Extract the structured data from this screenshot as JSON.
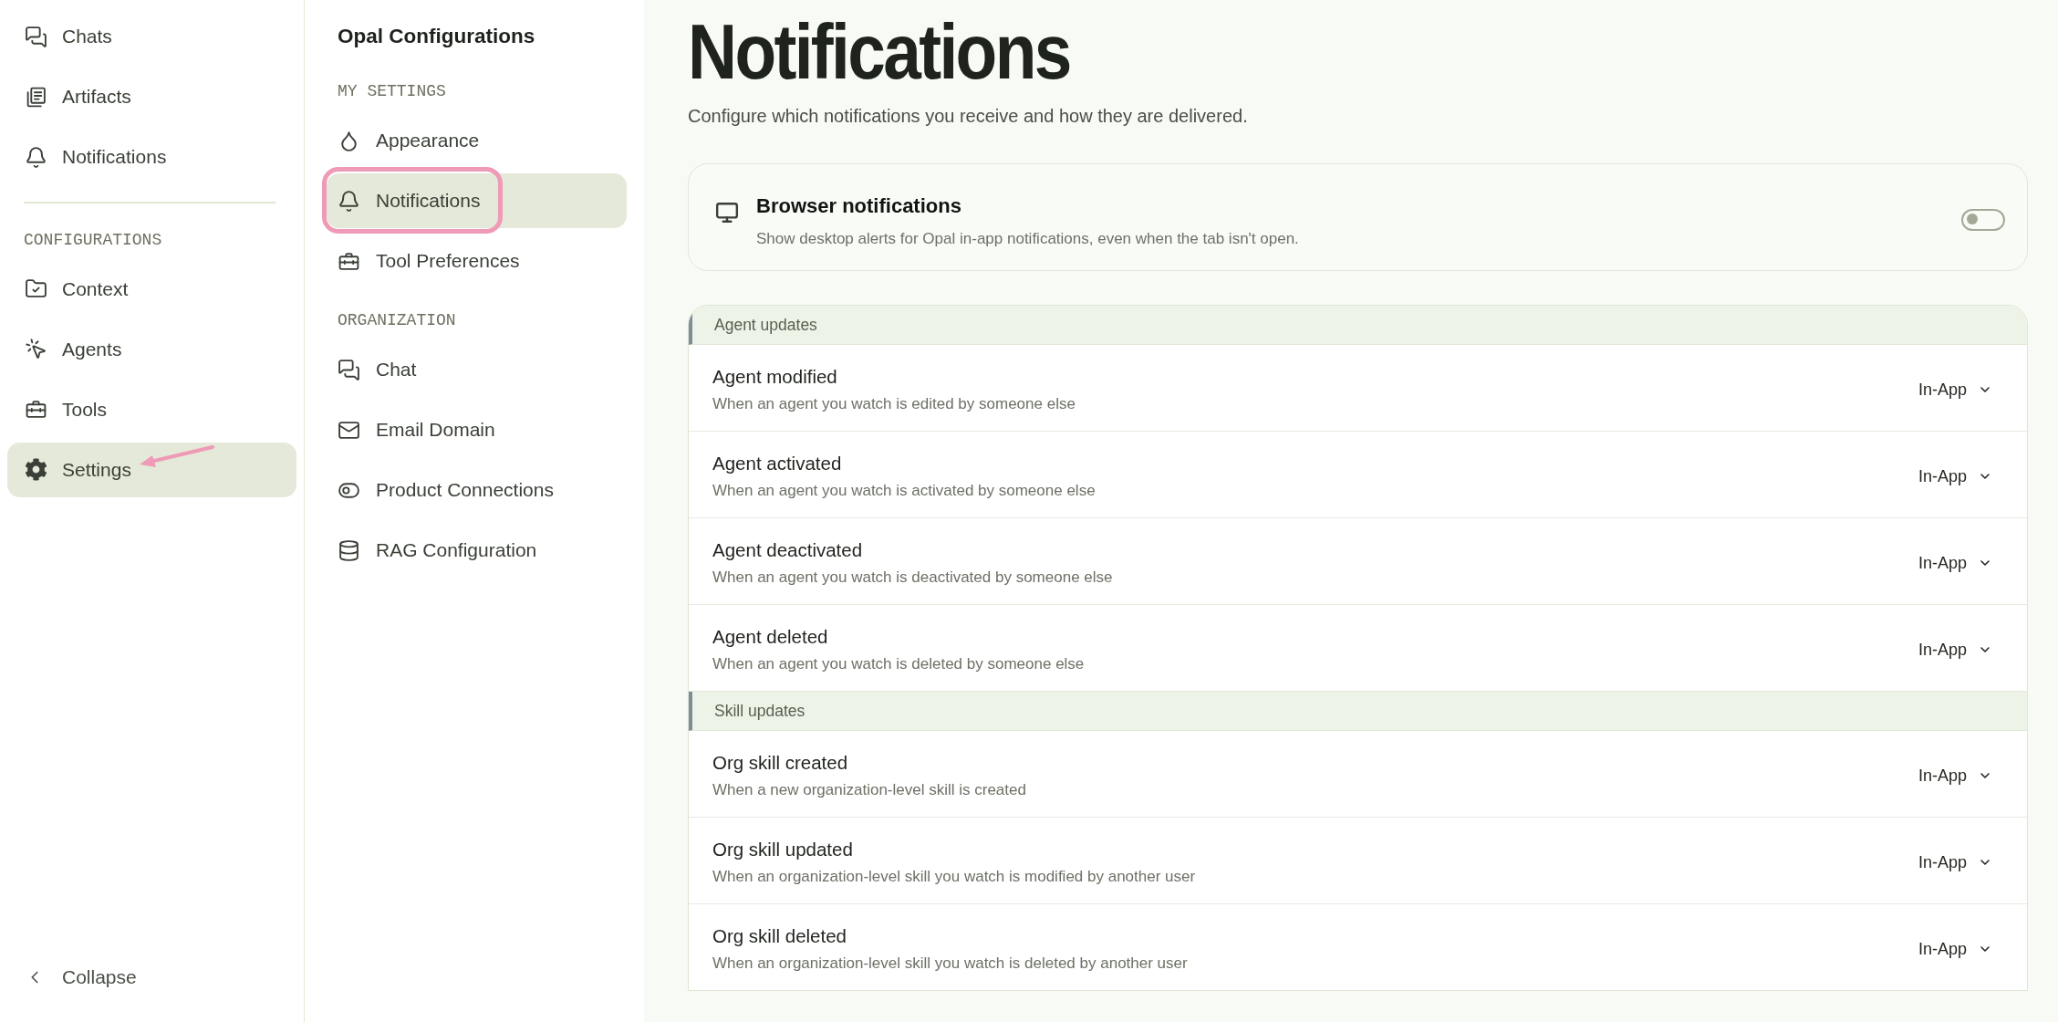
{
  "sidebar": {
    "items": [
      {
        "label": "Chats",
        "selected": false,
        "pointed_at": false
      },
      {
        "label": "Artifacts",
        "selected": false,
        "pointed_at": false
      },
      {
        "label": "Notifications",
        "selected": false,
        "pointed_at": false
      }
    ],
    "section": {
      "label": "CONFIGURATIONS",
      "items": [
        {
          "label": "Context",
          "selected": false,
          "pointed_at": false
        },
        {
          "label": "Agents",
          "selected": false,
          "pointed_at": false
        },
        {
          "label": "Tools",
          "selected": false,
          "pointed_at": false
        },
        {
          "label": "Settings",
          "selected": true,
          "pointed_at": true
        }
      ]
    },
    "collapse": {
      "label": "Collapse"
    }
  },
  "settings_nav": {
    "title": "Opal Configurations",
    "sections": [
      {
        "label": "MY SETTINGS",
        "items": [
          {
            "label": "Appearance",
            "selected": false,
            "circled": false
          },
          {
            "label": "Notifications",
            "selected": true,
            "circled": true
          },
          {
            "label": "Tool Preferences",
            "selected": false,
            "circled": false
          }
        ]
      },
      {
        "label": "ORGANIZATION",
        "items": [
          {
            "label": "Chat",
            "selected": false,
            "circled": false
          },
          {
            "label": "Email Domain",
            "selected": false,
            "circled": false
          },
          {
            "label": "Product Connections",
            "selected": false,
            "circled": false
          },
          {
            "label": "RAG Configuration",
            "selected": false,
            "circled": false
          }
        ]
      }
    ]
  },
  "page": {
    "title": "Notifications",
    "subtitle": "Configure which notifications you receive and how they are delivered."
  },
  "browser_notifications": {
    "title": "Browser notifications",
    "description": "Show desktop alerts for Opal in-app notifications, even when the tab isn't open.",
    "on": false
  },
  "groups": [
    {
      "label": "Agent updates",
      "rows": [
        {
          "title": "Agent modified",
          "description": "When an agent you watch is edited by someone else",
          "channel": "In-App"
        },
        {
          "title": "Agent activated",
          "description": "When an agent you watch is activated by someone else",
          "channel": "In-App"
        },
        {
          "title": "Agent deactivated",
          "description": "When an agent you watch is deactivated by someone else",
          "channel": "In-App"
        },
        {
          "title": "Agent deleted",
          "description": "When an agent you watch is deleted by someone else",
          "channel": "In-App"
        }
      ]
    },
    {
      "label": "Skill updates",
      "rows": [
        {
          "title": "Org skill created",
          "description": "When a new organization-level skill is created",
          "channel": "In-App"
        },
        {
          "title": "Org skill updated",
          "description": "When an organization-level skill you watch is modified by another user",
          "channel": "In-App"
        },
        {
          "title": "Org skill deleted",
          "description": "When an organization-level skill you watch is deleted by another user",
          "channel": "In-App"
        }
      ]
    }
  ]
}
